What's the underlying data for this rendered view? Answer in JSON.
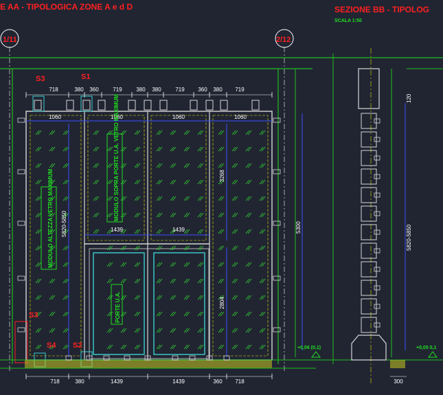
{
  "section_aa": {
    "title": "E AA - TIPOLOGICA ZONE A e d D",
    "axis_left": "1/11",
    "axis_right": "2/12"
  },
  "section_bb": {
    "title": "SEZIONE BB - TIPOLOG",
    "scale": "SCALA 1:50"
  },
  "markers": {
    "s3": "S3",
    "s1": "S1",
    "s2": "S2",
    "s4": "S4"
  },
  "top_dims": [
    "718",
    "380",
    "360",
    "719",
    "380",
    "380",
    "719",
    "360",
    "380",
    "719"
  ],
  "panel_widths": [
    "1060",
    "1060",
    "1060",
    "1060"
  ],
  "door_widths": [
    "1439",
    "1439"
  ],
  "bottom_dims": [
    "718",
    "380",
    "1439",
    "1439",
    "360",
    "718"
  ],
  "vertical_dims": {
    "total_height": "5300",
    "range_left": "5820-5850",
    "right_upper": "3268",
    "right_lower": "2804",
    "section_range": "5820-5850",
    "section_top": "120",
    "section_base": "300"
  },
  "labels": {
    "module_left": "MODULO ALTEZZA VETRO MAXIMUM",
    "module_center": "MODULO SOPRA PORTE U.A. VETRO MAXIMUM",
    "door_label": "PORTE U.A.",
    "level_a": "+0,06 (0,1)",
    "level_b": "+0,05 0,1"
  }
}
